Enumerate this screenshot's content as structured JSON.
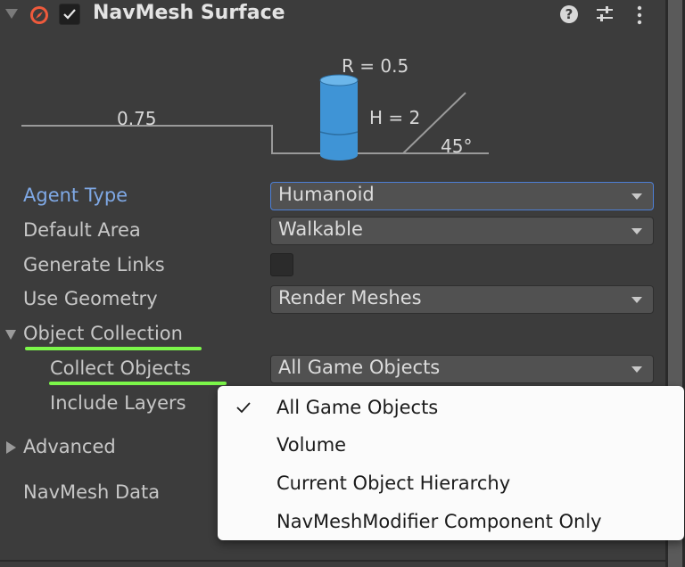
{
  "component": {
    "title": "NavMesh Surface",
    "enabled": true
  },
  "header_icons": [
    "navmesh-surface-icon",
    "help-icon",
    "presets-icon",
    "kebab-menu-icon"
  ],
  "diagram": {
    "radius_label": "R = 0.5",
    "height_label": "H = 2",
    "step_label": "0.75",
    "slope_label": "45°"
  },
  "fields": {
    "agent_type": {
      "label": "Agent Type",
      "value": "Humanoid"
    },
    "default_area": {
      "label": "Default Area",
      "value": "Walkable"
    },
    "generate_links": {
      "label": "Generate Links",
      "checked": false
    },
    "use_geometry": {
      "label": "Use Geometry",
      "value": "Render Meshes"
    }
  },
  "object_collection": {
    "label": "Object Collection",
    "collect_objects": {
      "label": "Collect Objects",
      "value": "All Game Objects"
    },
    "include_layers": {
      "label": "Include Layers"
    }
  },
  "advanced": {
    "label": "Advanced"
  },
  "navmesh_data": {
    "label": "NavMesh Data"
  },
  "popup": {
    "options": [
      {
        "label": "All Game Objects",
        "selected": true
      },
      {
        "label": "Volume",
        "selected": false
      },
      {
        "label": "Current Object Hierarchy",
        "selected": false
      },
      {
        "label": "NavMeshModifier Component Only",
        "selected": false
      }
    ]
  },
  "colors": {
    "highlight": "#7cf74a",
    "accent_label": "#7fa9e6",
    "cylinder": "#3f94d6"
  }
}
